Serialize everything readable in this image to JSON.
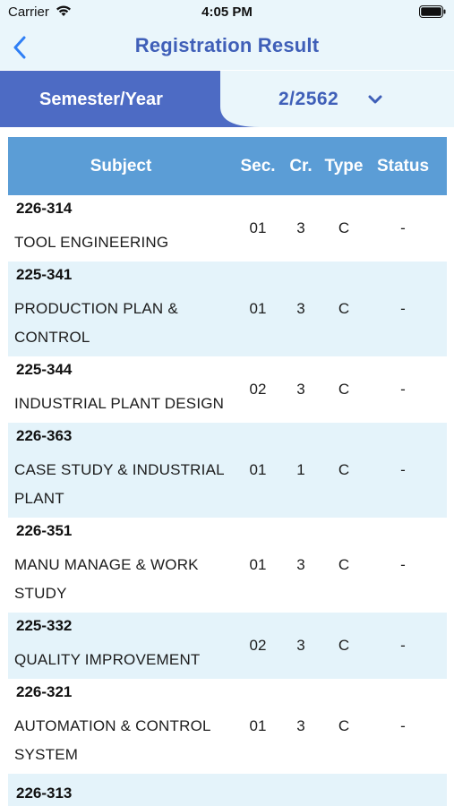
{
  "status_bar": {
    "carrier": "Carrier",
    "time": "4:05 PM"
  },
  "nav": {
    "title": "Registration Result",
    "back_icon": "chevron-left-icon"
  },
  "semester": {
    "label": "Semester/Year",
    "value": "2/2562",
    "dropdown_icon": "chevron-down-icon"
  },
  "table": {
    "headers": {
      "subject": "Subject",
      "sec": "Sec.",
      "cr": "Cr.",
      "type": "Type",
      "status": "Status"
    },
    "rows": [
      {
        "code": "226-314",
        "name_lines": [
          "TOOL ENGINEERING"
        ],
        "sec": "01",
        "cr": "3",
        "type": "C",
        "status": "-"
      },
      {
        "code": "225-341",
        "name_lines": [
          "PRODUCTION PLAN &",
          "CONTROL"
        ],
        "sec": "01",
        "cr": "3",
        "type": "C",
        "status": "-"
      },
      {
        "code": "225-344",
        "name_lines": [
          "INDUSTRIAL PLANT DESIGN"
        ],
        "sec": "02",
        "cr": "3",
        "type": "C",
        "status": "-"
      },
      {
        "code": "226-363",
        "name_lines": [
          "CASE STUDY & INDUSTRIAL",
          "PLANT"
        ],
        "sec": "01",
        "cr": "1",
        "type": "C",
        "status": "-"
      },
      {
        "code": "226-351",
        "name_lines": [
          "MANU MANAGE & WORK",
          "STUDY"
        ],
        "sec": "01",
        "cr": "3",
        "type": "C",
        "status": "-"
      },
      {
        "code": "225-332",
        "name_lines": [
          "QUALITY IMPROVEMENT"
        ],
        "sec": "02",
        "cr": "3",
        "type": "C",
        "status": "-"
      },
      {
        "code": "226-321",
        "name_lines": [
          "AUTOMATION & CONTROL",
          "SYSTEM"
        ],
        "sec": "01",
        "cr": "3",
        "type": "C",
        "status": "-"
      },
      {
        "code": "226-313",
        "name_lines": [],
        "sec": "",
        "cr": "",
        "type": "",
        "status": ""
      }
    ]
  },
  "colors": {
    "accent": "#3f5fb8",
    "header_blue": "#5b9dd6",
    "row_alt": "#e4f3fa",
    "bar_bg": "#eaf6fb"
  }
}
